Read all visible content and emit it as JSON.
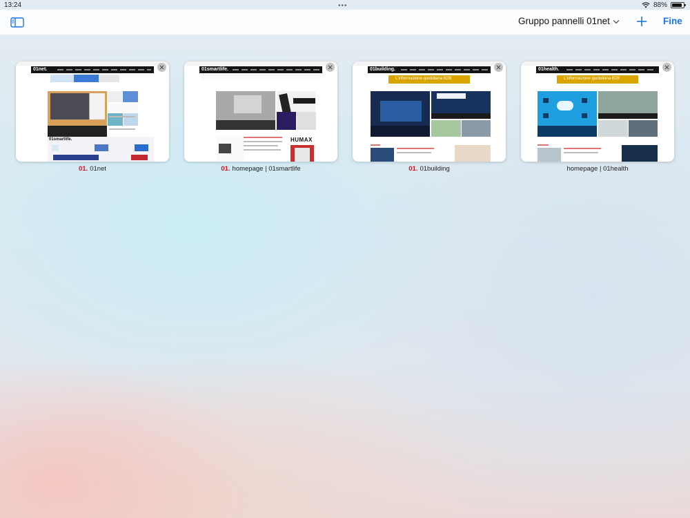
{
  "status_bar": {
    "time": "13:24",
    "battery": "88%",
    "battery_level": 0.88,
    "icons": [
      "wifi-icon",
      "battery-icon"
    ]
  },
  "toolbar": {
    "group_title": "Gruppo pannelli 01net",
    "done_label": "Fine",
    "icons": [
      "sidebar-icon",
      "chevron-down-icon",
      "plus-icon"
    ]
  },
  "tabs": [
    {
      "brand": "01.",
      "title": "01net"
    },
    {
      "brand": "01.",
      "title": "homepage | 01smartlife"
    },
    {
      "brand": "01.",
      "title": "01building"
    },
    {
      "brand": "",
      "title": "homepage | 01health"
    }
  ],
  "thumbnails": {
    "logos": [
      "01net.",
      "01smartlife.",
      "01building.",
      "01health."
    ],
    "banner_text": "L'informazione quotidiana B2B",
    "humax_text": "HUMAX",
    "colors": {
      "brand_red": "#e30613",
      "header_black": "#141414",
      "banner_gold": "#d9a400",
      "accent_blue": "#1a73e8"
    }
  }
}
